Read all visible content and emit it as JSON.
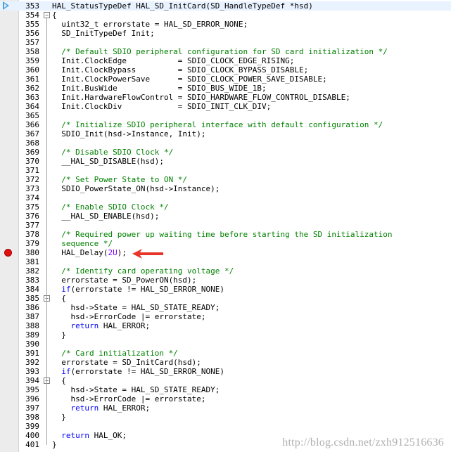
{
  "editor": {
    "current_line": "353",
    "breakpoint_line": "380",
    "annotated_line": "380",
    "lines": [
      {
        "n": "353",
        "tokens": [
          {
            "t": "plain",
            "v": "HAL_StatusTypeDef HAL_SD_InitCard(SD_HandleTypeDef *hsd)"
          }
        ]
      },
      {
        "n": "354",
        "tokens": [
          {
            "t": "plain",
            "v": "{"
          }
        ]
      },
      {
        "n": "355",
        "tokens": [
          {
            "t": "plain",
            "v": "  uint32_t errorstate = HAL_SD_ERROR_NONE;"
          }
        ]
      },
      {
        "n": "356",
        "tokens": [
          {
            "t": "plain",
            "v": "  SD_InitTypeDef Init;"
          }
        ]
      },
      {
        "n": "357",
        "tokens": []
      },
      {
        "n": "358",
        "tokens": [
          {
            "t": "comment",
            "v": "  /* Default SDIO peripheral configuration for SD card initialization */"
          }
        ]
      },
      {
        "n": "359",
        "tokens": [
          {
            "t": "plain",
            "v": "  Init.ClockEdge           = SDIO_CLOCK_EDGE_RISING;"
          }
        ]
      },
      {
        "n": "360",
        "tokens": [
          {
            "t": "plain",
            "v": "  Init.ClockBypass         = SDIO_CLOCK_BYPASS_DISABLE;"
          }
        ]
      },
      {
        "n": "361",
        "tokens": [
          {
            "t": "plain",
            "v": "  Init.ClockPowerSave      = SDIO_CLOCK_POWER_SAVE_DISABLE;"
          }
        ]
      },
      {
        "n": "362",
        "tokens": [
          {
            "t": "plain",
            "v": "  Init.BusWide             = SDIO_BUS_WIDE_1B;"
          }
        ]
      },
      {
        "n": "363",
        "tokens": [
          {
            "t": "plain",
            "v": "  Init.HardwareFlowControl = SDIO_HARDWARE_FLOW_CONTROL_DISABLE;"
          }
        ]
      },
      {
        "n": "364",
        "tokens": [
          {
            "t": "plain",
            "v": "  Init.ClockDiv            = SDIO_INIT_CLK_DIV;"
          }
        ]
      },
      {
        "n": "365",
        "tokens": []
      },
      {
        "n": "366",
        "tokens": [
          {
            "t": "comment",
            "v": "  /* Initialize SDIO peripheral interface with default configuration */"
          }
        ]
      },
      {
        "n": "367",
        "tokens": [
          {
            "t": "plain",
            "v": "  SDIO_Init(hsd->Instance, Init);"
          }
        ]
      },
      {
        "n": "368",
        "tokens": []
      },
      {
        "n": "369",
        "tokens": [
          {
            "t": "comment",
            "v": "  /* Disable SDIO Clock */"
          }
        ]
      },
      {
        "n": "370",
        "tokens": [
          {
            "t": "plain",
            "v": "  __HAL_SD_DISABLE(hsd);"
          }
        ]
      },
      {
        "n": "371",
        "tokens": []
      },
      {
        "n": "372",
        "tokens": [
          {
            "t": "comment",
            "v": "  /* Set Power State to ON */"
          }
        ]
      },
      {
        "n": "373",
        "tokens": [
          {
            "t": "plain",
            "v": "  SDIO_PowerState_ON(hsd->Instance);"
          }
        ]
      },
      {
        "n": "374",
        "tokens": []
      },
      {
        "n": "375",
        "tokens": [
          {
            "t": "comment",
            "v": "  /* Enable SDIO Clock */"
          }
        ]
      },
      {
        "n": "376",
        "tokens": [
          {
            "t": "plain",
            "v": "  __HAL_SD_ENABLE(hsd);"
          }
        ]
      },
      {
        "n": "377",
        "tokens": []
      },
      {
        "n": "378",
        "tokens": [
          {
            "t": "comment",
            "v": "  /* Required power up waiting time before starting the SD initialization"
          }
        ]
      },
      {
        "n": "379",
        "tokens": [
          {
            "t": "comment",
            "v": "  sequence */"
          }
        ]
      },
      {
        "n": "380",
        "tokens": [
          {
            "t": "plain",
            "v": "  HAL_Delay("
          },
          {
            "t": "number",
            "v": "2U"
          },
          {
            "t": "plain",
            "v": ");"
          }
        ]
      },
      {
        "n": "381",
        "tokens": []
      },
      {
        "n": "382",
        "tokens": [
          {
            "t": "comment",
            "v": "  /* Identify card operating voltage */"
          }
        ]
      },
      {
        "n": "383",
        "tokens": [
          {
            "t": "plain",
            "v": "  errorstate = SD_PowerON(hsd);"
          }
        ]
      },
      {
        "n": "384",
        "tokens": [
          {
            "t": "plain",
            "v": "  "
          },
          {
            "t": "keyword",
            "v": "if"
          },
          {
            "t": "plain",
            "v": "(errorstate != HAL_SD_ERROR_NONE)"
          }
        ]
      },
      {
        "n": "385",
        "tokens": [
          {
            "t": "plain",
            "v": "  {"
          }
        ]
      },
      {
        "n": "386",
        "tokens": [
          {
            "t": "plain",
            "v": "    hsd->State = HAL_SD_STATE_READY;"
          }
        ]
      },
      {
        "n": "387",
        "tokens": [
          {
            "t": "plain",
            "v": "    hsd->ErrorCode |= errorstate;"
          }
        ]
      },
      {
        "n": "388",
        "tokens": [
          {
            "t": "plain",
            "v": "    "
          },
          {
            "t": "keyword",
            "v": "return"
          },
          {
            "t": "plain",
            "v": " HAL_ERROR;"
          }
        ]
      },
      {
        "n": "389",
        "tokens": [
          {
            "t": "plain",
            "v": "  }"
          }
        ]
      },
      {
        "n": "390",
        "tokens": []
      },
      {
        "n": "391",
        "tokens": [
          {
            "t": "comment",
            "v": "  /* Card initialization */"
          }
        ]
      },
      {
        "n": "392",
        "tokens": [
          {
            "t": "plain",
            "v": "  errorstate = SD_InitCard(hsd);"
          }
        ]
      },
      {
        "n": "393",
        "tokens": [
          {
            "t": "plain",
            "v": "  "
          },
          {
            "t": "keyword",
            "v": "if"
          },
          {
            "t": "plain",
            "v": "(errorstate != HAL_SD_ERROR_NONE)"
          }
        ]
      },
      {
        "n": "394",
        "tokens": [
          {
            "t": "plain",
            "v": "  {"
          }
        ]
      },
      {
        "n": "395",
        "tokens": [
          {
            "t": "plain",
            "v": "    hsd->State = HAL_SD_STATE_READY;"
          }
        ]
      },
      {
        "n": "396",
        "tokens": [
          {
            "t": "plain",
            "v": "    hsd->ErrorCode |= errorstate;"
          }
        ]
      },
      {
        "n": "397",
        "tokens": [
          {
            "t": "plain",
            "v": "    "
          },
          {
            "t": "keyword",
            "v": "return"
          },
          {
            "t": "plain",
            "v": " HAL_ERROR;"
          }
        ]
      },
      {
        "n": "398",
        "tokens": [
          {
            "t": "plain",
            "v": "  }"
          }
        ]
      },
      {
        "n": "399",
        "tokens": []
      },
      {
        "n": "400",
        "tokens": [
          {
            "t": "plain",
            "v": "  "
          },
          {
            "t": "keyword",
            "v": "return"
          },
          {
            "t": "plain",
            "v": " HAL_OK;"
          }
        ]
      },
      {
        "n": "401",
        "tokens": [
          {
            "t": "plain",
            "v": "}"
          }
        ]
      }
    ],
    "fold_markers": [
      {
        "line": "354",
        "symbol": "−"
      },
      {
        "line": "385",
        "symbol": "−"
      },
      {
        "line": "394",
        "symbol": "−"
      }
    ]
  },
  "icons": {
    "current_line_marker": "current-line-arrow-icon",
    "breakpoint": "breakpoint-icon",
    "annotation": "red-arrow-icon"
  },
  "colors": {
    "comment": "#008000",
    "keyword": "#0000ff",
    "number": "#8000ff",
    "breakpoint": "#e01010",
    "annotation_arrow": "#e8352a",
    "current_marker": "#4aa3e0"
  },
  "watermark": "http://blog.csdn.net/zxh912516636"
}
